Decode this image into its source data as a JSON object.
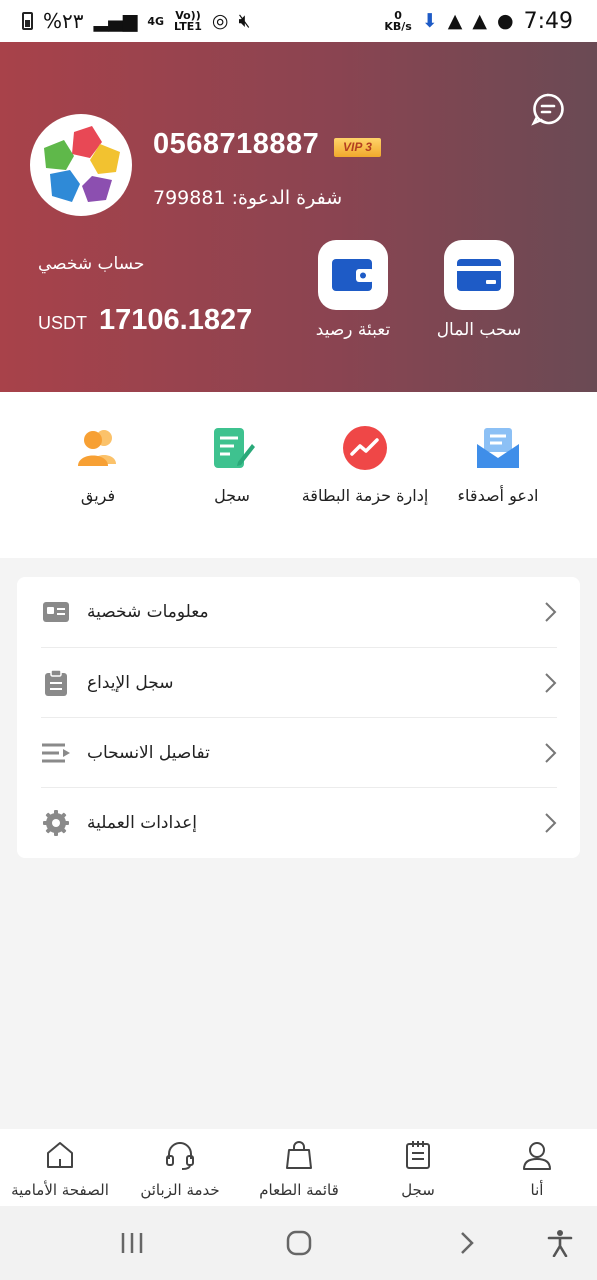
{
  "status_bar": {
    "battery_percent": "%٢٣",
    "network": "4G",
    "volte": "Vo))",
    "lte": "LTE1",
    "net_speed_value": "0",
    "net_speed_unit": "KB/s",
    "time": "7:49"
  },
  "profile": {
    "phone": "0568718887",
    "vip_badge": "VIP 3",
    "invite_label": "شفرة الدعوة:",
    "invite_code": "799881",
    "account_label": "حساب شخصي",
    "currency": "USDT",
    "balance": "17106.1827"
  },
  "header_actions": [
    {
      "label": "تعبئة رصيد",
      "icon": "wallet-icon"
    },
    {
      "label": "سحب المال",
      "icon": "card-icon"
    }
  ],
  "quick_actions": [
    {
      "label": "فريق",
      "icon": "team-icon"
    },
    {
      "label": "سجل",
      "icon": "record-icon"
    },
    {
      "label": "إدارة حزمة البطاقة",
      "icon": "chart-icon"
    },
    {
      "label": "ادعو أصدقاء",
      "icon": "invite-icon"
    }
  ],
  "menu": [
    {
      "label": "معلومات شخصية",
      "icon": "id-card-icon"
    },
    {
      "label": "سجل الإيداع",
      "icon": "clipboard-icon"
    },
    {
      "label": "تفاصيل الانسحاب",
      "icon": "list-arrow-icon"
    },
    {
      "label": "إعدادات العملية",
      "icon": "gear-icon"
    }
  ],
  "bottom_nav": [
    {
      "label": "الصفحة الأمامية",
      "icon": "home-icon"
    },
    {
      "label": "خدمة الزبائن",
      "icon": "headset-icon"
    },
    {
      "label": "قائمة الطعام",
      "icon": "bag-icon"
    },
    {
      "label": "سجل",
      "icon": "notepad-icon"
    },
    {
      "label": "أنا",
      "icon": "user-icon"
    }
  ],
  "colors": {
    "header_start": "#a8424a",
    "header_end": "#6a4a54",
    "accent_blue": "#1e5bc6",
    "team_orange": "#f7a034",
    "record_green": "#3ec28f",
    "chart_red": "#ef4747",
    "invite_blue": "#3f8ee9"
  }
}
